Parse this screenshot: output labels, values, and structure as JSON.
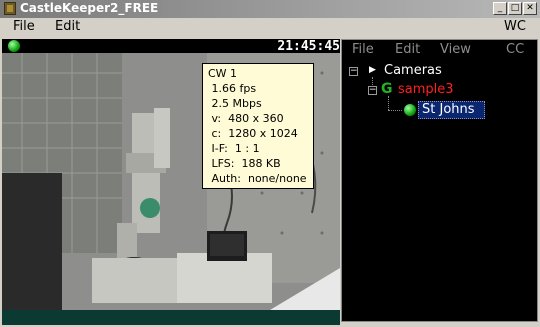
{
  "window": {
    "title": "CastleKeeper2_FREE",
    "buttons": [
      "_",
      "□",
      "✕"
    ]
  },
  "menubar": {
    "file": "File",
    "edit": "Edit",
    "wc": "WC"
  },
  "video": {
    "clock": "21:45:45",
    "info": [
      "CW 1",
      " 1.66 fps",
      " 2.5 Mbps",
      " v:  480 x 360",
      " c:  1280 x 1024",
      " I-F:  1 : 1",
      " LFS:  188 KB",
      " Auth:  none/none"
    ]
  },
  "panel": {
    "menu": {
      "file": "File",
      "edit": "Edit",
      "view": "View",
      "cc": "CC"
    },
    "tree": {
      "root": "Cameras",
      "group": "sample3",
      "camera": "St Johns"
    },
    "colors": {
      "group": "#ff2020",
      "selected_bg": "#0a2670"
    }
  }
}
